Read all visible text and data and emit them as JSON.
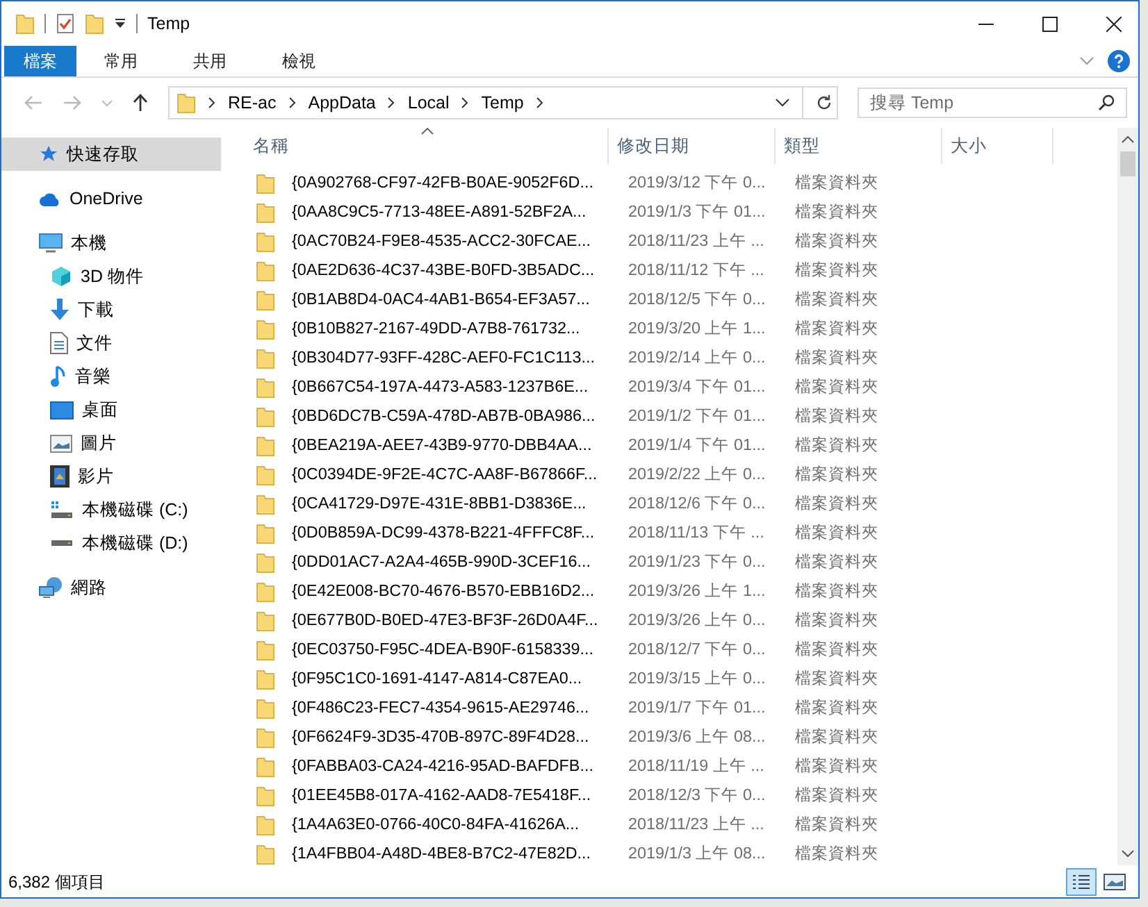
{
  "window": {
    "title": "Temp"
  },
  "ribbon": {
    "tabs": [
      {
        "label": "檔案",
        "kind": "file",
        "selected": false
      },
      {
        "label": "常用",
        "kind": "tab",
        "selected": false
      },
      {
        "label": "共用",
        "kind": "tab",
        "selected": false
      },
      {
        "label": "檢視",
        "kind": "tab",
        "selected": false
      }
    ]
  },
  "address": {
    "path": [
      "RE-ac",
      "AppData",
      "Local",
      "Temp"
    ]
  },
  "search": {
    "placeholder": "搜尋 Temp"
  },
  "sidebar": {
    "items": [
      {
        "label": "快速存取",
        "kind": "star",
        "selected": true
      },
      {
        "label": "OneDrive",
        "kind": "cloud",
        "selected": false
      },
      {
        "label": "本機",
        "kind": "pc",
        "selected": false,
        "children": [
          {
            "label": "3D 物件",
            "kind": "cube",
            "selected": false
          },
          {
            "label": "下載",
            "kind": "download",
            "selected": false
          },
          {
            "label": "文件",
            "kind": "doc",
            "selected": false
          },
          {
            "label": "音樂",
            "kind": "music",
            "selected": false
          },
          {
            "label": "桌面",
            "kind": "desktop",
            "selected": false
          },
          {
            "label": "圖片",
            "kind": "picture",
            "selected": false
          },
          {
            "label": "影片",
            "kind": "video",
            "selected": false
          },
          {
            "label": "本機磁碟 (C:)",
            "kind": "systemdrive",
            "selected": false
          },
          {
            "label": "本機磁碟 (D:)",
            "kind": "drive",
            "selected": false
          }
        ]
      },
      {
        "label": "網路",
        "kind": "network",
        "selected": false
      }
    ]
  },
  "table": {
    "columns": [
      {
        "label": "名稱",
        "sorted": true
      },
      {
        "label": "修改日期",
        "sorted": false
      },
      {
        "label": "類型",
        "sorted": false
      },
      {
        "label": "大小",
        "sorted": false
      }
    ],
    "rows": [
      {
        "name": "{0A902768-CF97-42FB-B0AE-9052F6D...",
        "date": "2019/3/12 下午 0...",
        "type": "檔案資料夾"
      },
      {
        "name": "{0AA8C9C5-7713-48EE-A891-52BF2A...",
        "date": "2019/1/3 下午 01...",
        "type": "檔案資料夾"
      },
      {
        "name": "{0AC70B24-F9E8-4535-ACC2-30FCAE...",
        "date": "2018/11/23 上午 ...",
        "type": "檔案資料夾"
      },
      {
        "name": "{0AE2D636-4C37-43BE-B0FD-3B5ADC...",
        "date": "2018/11/12 下午 ...",
        "type": "檔案資料夾"
      },
      {
        "name": "{0B1AB8D4-0AC4-4AB1-B654-EF3A57...",
        "date": "2018/12/5 下午 0...",
        "type": "檔案資料夾"
      },
      {
        "name": "{0B10B827-2167-49DD-A7B8-761732...",
        "date": "2019/3/20 上午 1...",
        "type": "檔案資料夾"
      },
      {
        "name": "{0B304D77-93FF-428C-AEF0-FC1C113...",
        "date": "2019/2/14 上午 0...",
        "type": "檔案資料夾"
      },
      {
        "name": "{0B667C54-197A-4473-A583-1237B6E...",
        "date": "2019/3/4 下午 01...",
        "type": "檔案資料夾"
      },
      {
        "name": "{0BD6DC7B-C59A-478D-AB7B-0BA986...",
        "date": "2019/1/2 下午 01...",
        "type": "檔案資料夾"
      },
      {
        "name": "{0BEA219A-AEE7-43B9-9770-DBB4AA...",
        "date": "2019/1/4 下午 01...",
        "type": "檔案資料夾"
      },
      {
        "name": "{0C0394DE-9F2E-4C7C-AA8F-B67866F...",
        "date": "2019/2/22 上午 0...",
        "type": "檔案資料夾"
      },
      {
        "name": "{0CA41729-D97E-431E-8BB1-D3836E...",
        "date": "2018/12/6 下午 0...",
        "type": "檔案資料夾"
      },
      {
        "name": "{0D0B859A-DC99-4378-B221-4FFFC8F...",
        "date": "2018/11/13 下午 ...",
        "type": "檔案資料夾"
      },
      {
        "name": "{0DD01AC7-A2A4-465B-990D-3CEF16...",
        "date": "2019/1/23 下午 0...",
        "type": "檔案資料夾"
      },
      {
        "name": "{0E42E008-BC70-4676-B570-EBB16D2...",
        "date": "2019/3/26 上午 1...",
        "type": "檔案資料夾"
      },
      {
        "name": "{0E677B0D-B0ED-47E3-BF3F-26D0A4F...",
        "date": "2019/3/26 上午 0...",
        "type": "檔案資料夾"
      },
      {
        "name": "{0EC03750-F95C-4DEA-B90F-6158339...",
        "date": "2018/12/7 下午 0...",
        "type": "檔案資料夾"
      },
      {
        "name": "{0F95C1C0-1691-4147-A814-C87EA0...",
        "date": "2019/3/15 上午 0...",
        "type": "檔案資料夾"
      },
      {
        "name": "{0F486C23-FEC7-4354-9615-AE29746...",
        "date": "2019/1/7 下午 01...",
        "type": "檔案資料夾"
      },
      {
        "name": "{0F6624F9-3D35-470B-897C-89F4D28...",
        "date": "2019/3/6 上午 08...",
        "type": "檔案資料夾"
      },
      {
        "name": "{0FABBA03-CA24-4216-95AD-BAFDFB...",
        "date": "2018/11/19 上午 ...",
        "type": "檔案資料夾"
      },
      {
        "name": "{01EE45B8-017A-4162-AAD8-7E5418F...",
        "date": "2018/12/3 下午 0...",
        "type": "檔案資料夾"
      },
      {
        "name": "{1A4A63E0-0766-40C0-84FA-41626A...",
        "date": "2018/11/23 上午 ...",
        "type": "檔案資料夾"
      },
      {
        "name": "{1A4FBB04-A48D-4BE8-B7C2-47E82D...",
        "date": "2019/1/3 上午 08...",
        "type": "檔案資料夾"
      }
    ]
  },
  "status_bar": {
    "count": "6,382 個項目",
    "views": [
      {
        "kind": "details",
        "selected": true
      },
      {
        "kind": "thumbnails",
        "selected": false
      }
    ]
  }
}
